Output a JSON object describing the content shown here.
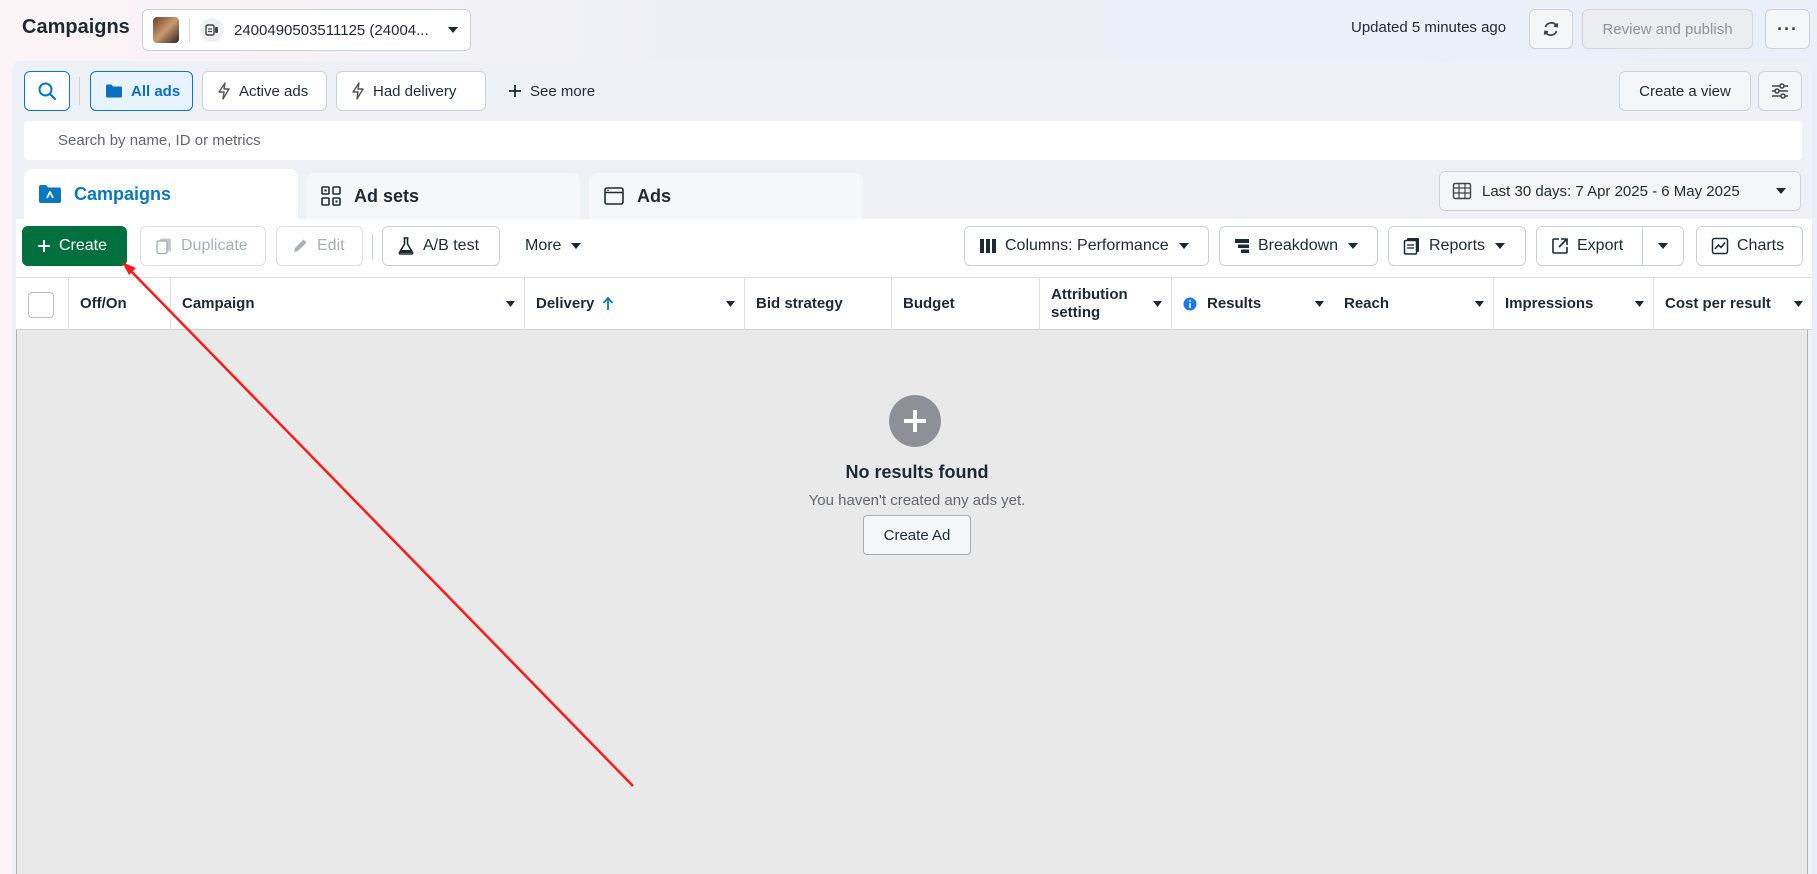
{
  "header": {
    "title": "Campaigns",
    "account_label": "2400490503511125 (24004...",
    "updated_text": "Updated 5 minutes ago",
    "review_publish_label": "Review and publish",
    "more_label": "···"
  },
  "filters": {
    "all_ads": "All ads",
    "active_ads": "Active ads",
    "had_delivery": "Had delivery",
    "see_more": "See more",
    "create_view": "Create a view"
  },
  "search": {
    "placeholder": "Search by name, ID or metrics"
  },
  "tabs": [
    {
      "label": "Campaigns"
    },
    {
      "label": "Ad sets"
    },
    {
      "label": "Ads"
    }
  ],
  "date_range": "Last 30 days: 7 Apr 2025 - 6 May 2025",
  "toolbar": {
    "create": "Create",
    "duplicate": "Duplicate",
    "edit": "Edit",
    "ab_test": "A/B test",
    "more": "More",
    "columns": "Columns: Performance",
    "breakdown": "Breakdown",
    "reports": "Reports",
    "export": "Export",
    "charts": "Charts"
  },
  "table": {
    "columns": [
      {
        "label": "Off/On"
      },
      {
        "label": "Campaign"
      },
      {
        "label": "Delivery"
      },
      {
        "label": "Bid strategy"
      },
      {
        "label": "Budget"
      },
      {
        "label": "Attribution setting"
      },
      {
        "label": "Results"
      },
      {
        "label": "Reach"
      },
      {
        "label": "Impressions"
      },
      {
        "label": "Cost per result"
      }
    ]
  },
  "empty_state": {
    "title": "No results found",
    "subtitle": "You haven't created any ads yet.",
    "button": "Create Ad"
  },
  "colors": {
    "accent_blue": "#0a78be",
    "create_green": "#00703f",
    "annotation_red": "#ff0000"
  }
}
